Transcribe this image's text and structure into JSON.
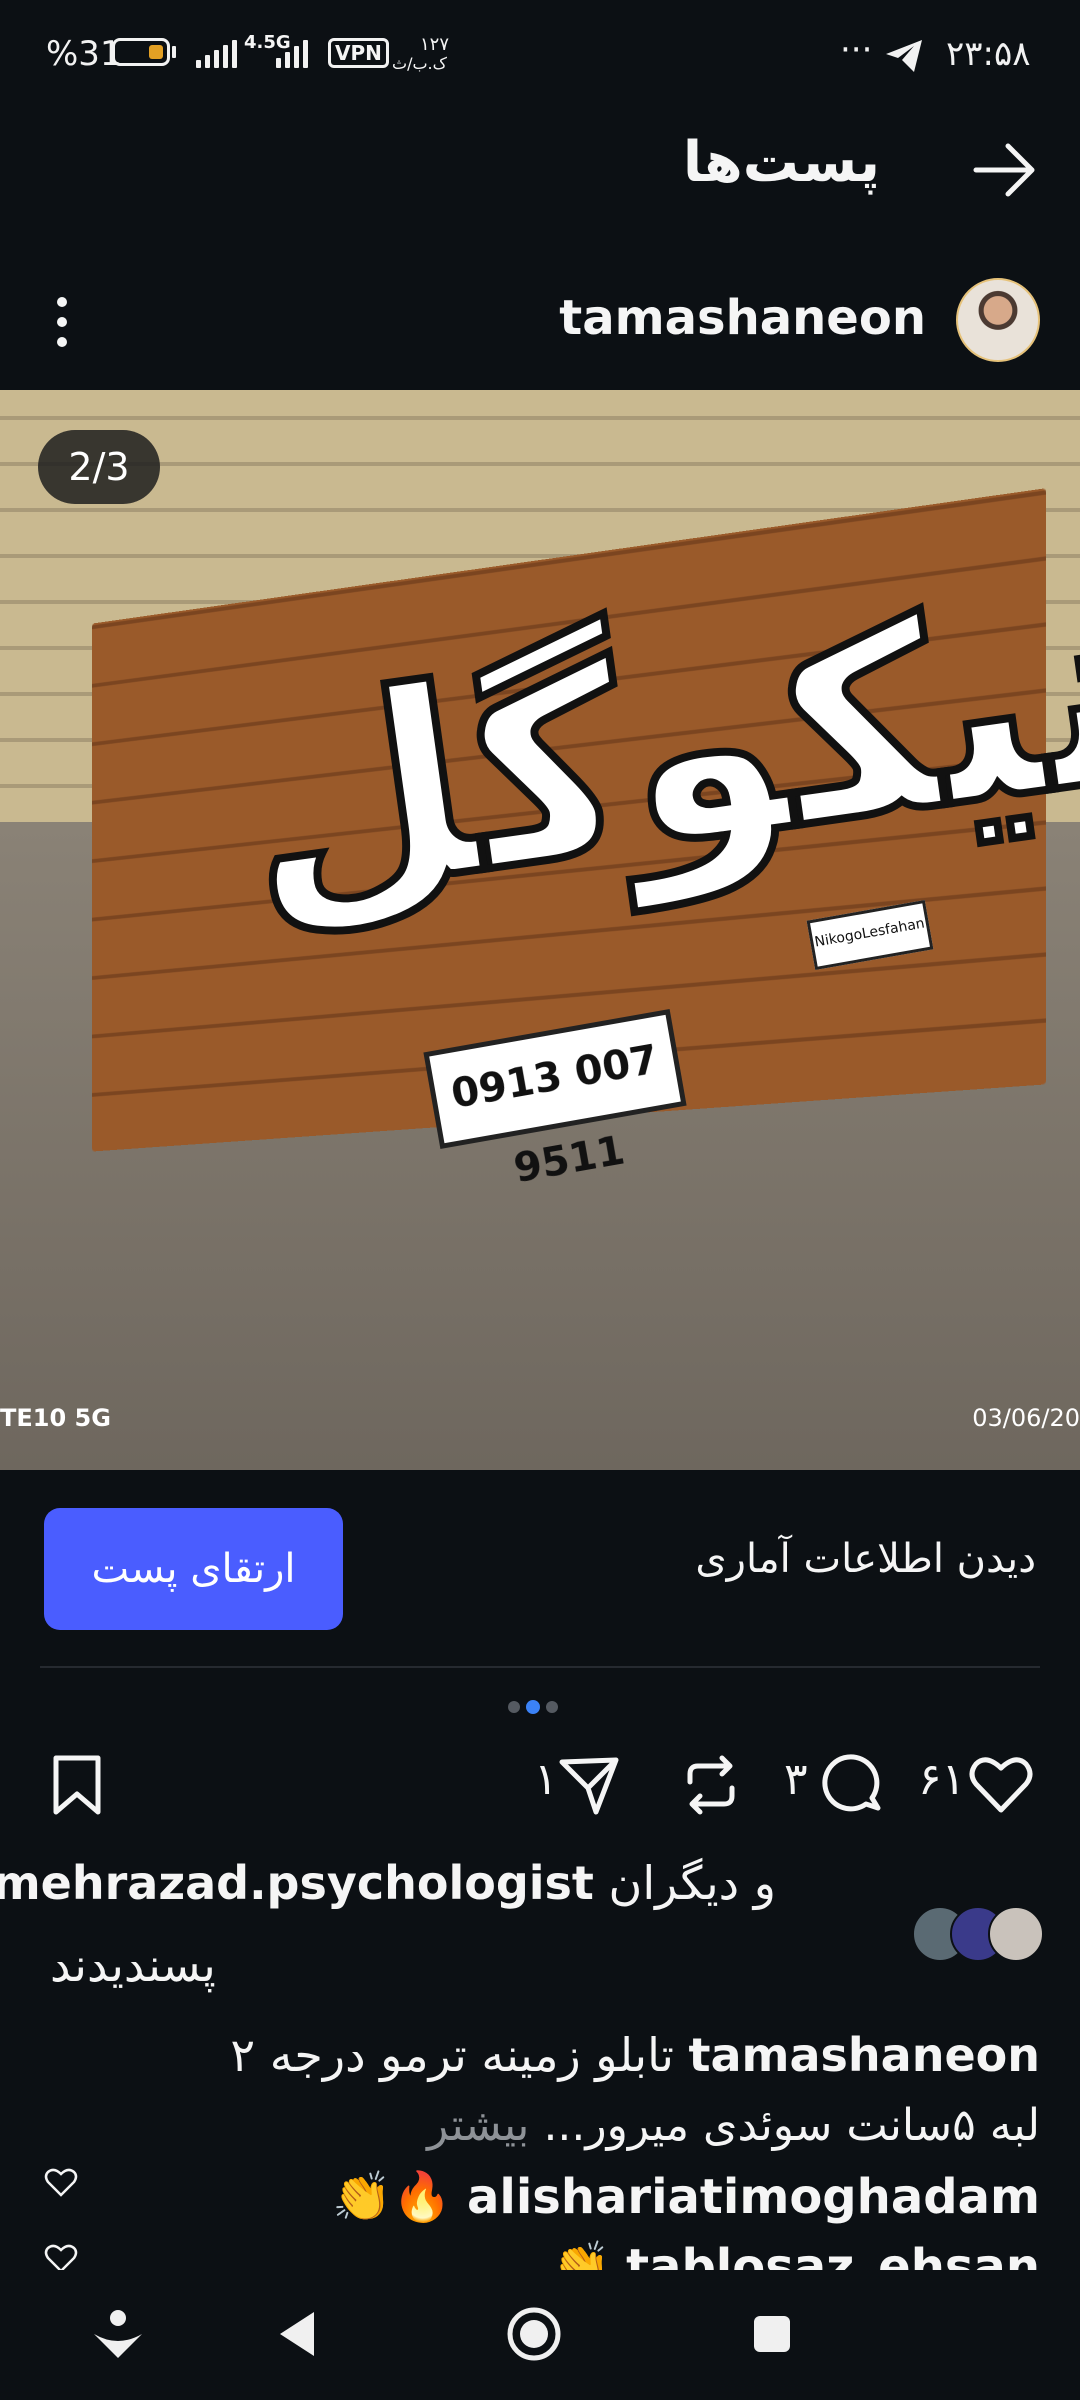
{
  "status_bar": {
    "time": "۲۳:۵۸",
    "battery": "%31",
    "network": "4.5G",
    "vpn": "VPN",
    "data_rate": "۱۲۷",
    "data_unit": "ک.ب/ث",
    "overflow": "···"
  },
  "header": {
    "title": "پست‌ها"
  },
  "post": {
    "username": "tamashaneon",
    "image": {
      "counter": "2/3",
      "sign_text": "نیکوگل",
      "phone_plate": "0913 007 9511",
      "insta_plate": "NikogoLesfahan",
      "watermark_left": "TE10 5G",
      "watermark_right": "03/06/20"
    },
    "promote_label": "ارتقای پست",
    "insights_label": "دیدن اطلاعات آماری",
    "carousel": {
      "count": 3,
      "active": 2
    },
    "actions": {
      "likes": "۶۱",
      "comments": "۳",
      "shares": "۱"
    },
    "liked_by": {
      "user": "mehrazad.psychologist",
      "others": "و دیگران",
      "suffix": "پسندیدند"
    },
    "caption": {
      "user": "tamashaneon",
      "line1": "تابلو زمینه ترمو درجه ۲",
      "line2": "لبه ۵سانت سوئدی میرور...",
      "more": "بیشتر"
    },
    "comments_preview": [
      {
        "user": "alishariatimoghadam",
        "text": "🔥👏"
      },
      {
        "user": "tablosaz_ehsan",
        "text": "👏"
      }
    ]
  },
  "colors": {
    "background": "#0c1014",
    "accent": "#4a5dff",
    "dot_active": "#3b82f6"
  },
  "icons": [
    "back-arrow-icon",
    "more-vertical-icon",
    "heart-icon",
    "comment-icon",
    "repost-icon",
    "share-icon",
    "bookmark-icon",
    "nav-download-icon",
    "nav-back-icon",
    "nav-home-icon",
    "nav-recents-icon"
  ]
}
